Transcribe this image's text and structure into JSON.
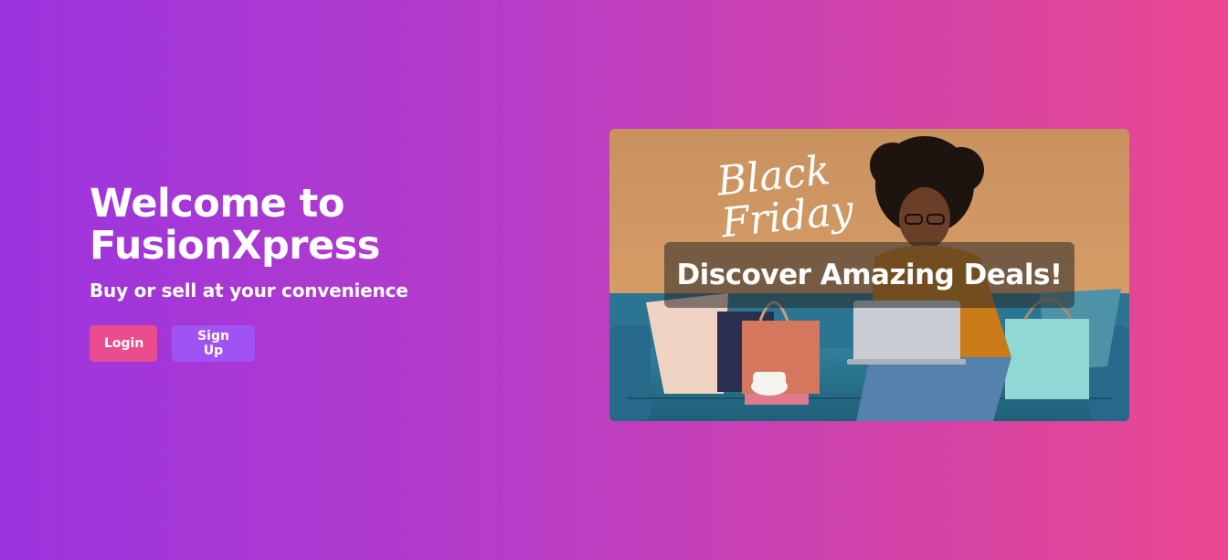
{
  "hero": {
    "title": "Welcome to FusionXpress",
    "subtitle": "Buy or sell at your convenience",
    "login_label": "Login",
    "signup_label": "Sign Up"
  },
  "banner": {
    "headline": "Discover Amazing Deals!",
    "script_line1": "Black",
    "script_line2": "Friday"
  },
  "colors": {
    "gradient_start": "#9b34df",
    "gradient_end": "#ea4790",
    "login_button": "#ea4c8e",
    "signup_button": "#a152f2"
  }
}
